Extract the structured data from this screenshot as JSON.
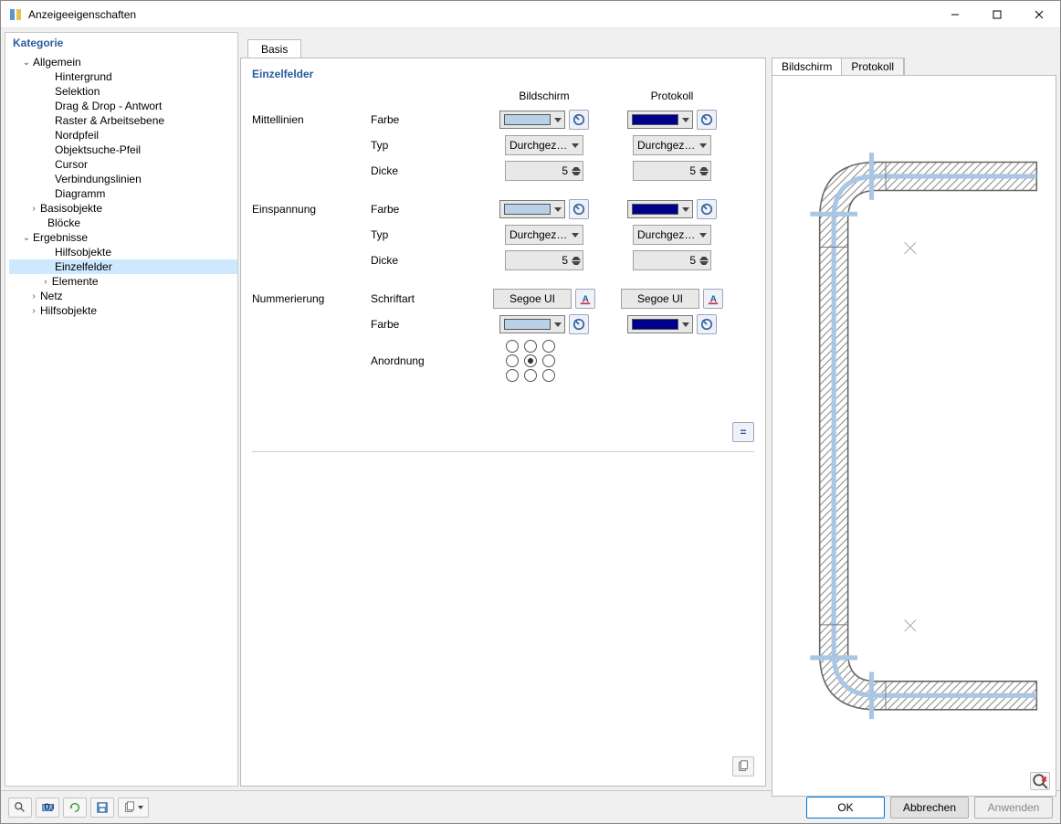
{
  "window": {
    "title": "Anzeigeeigenschaften"
  },
  "sidebar": {
    "header": "Kategorie",
    "items": [
      {
        "exp": "v",
        "label": "Allgemein"
      },
      {
        "exp": "",
        "label": "Hintergrund",
        "indent": 2
      },
      {
        "exp": "",
        "label": "Selektion",
        "indent": 2
      },
      {
        "exp": "",
        "label": "Drag & Drop - Antwort",
        "indent": 2
      },
      {
        "exp": "",
        "label": "Raster & Arbeitsebene",
        "indent": 2
      },
      {
        "exp": "",
        "label": "Nordpfeil",
        "indent": 2
      },
      {
        "exp": "",
        "label": "Objektsuche-Pfeil",
        "indent": 2
      },
      {
        "exp": "",
        "label": "Cursor",
        "indent": 2
      },
      {
        "exp": "",
        "label": "Verbindungslinien",
        "indent": 2
      },
      {
        "exp": "",
        "label": "Diagramm",
        "indent": 2
      },
      {
        "exp": ">",
        "label": "Basisobjekte",
        "indent": 1
      },
      {
        "exp": "",
        "label": "Blöcke",
        "indent": 1.5
      },
      {
        "exp": "v",
        "label": "Ergebnisse",
        "indent": 0.5
      },
      {
        "exp": "",
        "label": "Hilfsobjekte",
        "indent": 2
      },
      {
        "exp": "",
        "label": "Einzelfelder",
        "indent": 2,
        "selected": true
      },
      {
        "exp": ">",
        "label": "Elemente",
        "indent": 1.8
      },
      {
        "exp": ">",
        "label": "Netz",
        "indent": 1
      },
      {
        "exp": ">",
        "label": "Hilfsobjekte",
        "indent": 1
      }
    ]
  },
  "tabs": {
    "main": "Basis"
  },
  "settings": {
    "title": "Einzelfelder",
    "col_screen": "Bildschirm",
    "col_protocol": "Protokoll",
    "groups": {
      "mittellinien": {
        "label": "Mittellinien",
        "farbe": "Farbe",
        "typ": "Typ",
        "dicke": "Dicke",
        "typ_value": "Durchgezo...",
        "dicke_value": "5",
        "color_screen": "#b9d1e8",
        "color_protocol": "#00008b"
      },
      "einspannung": {
        "label": "Einspannung",
        "farbe": "Farbe",
        "typ": "Typ",
        "dicke": "Dicke",
        "typ_value": "Durchgezo...",
        "dicke_value": "5",
        "color_screen": "#b9d1e8",
        "color_protocol": "#00008b"
      },
      "nummerierung": {
        "label": "Nummerierung",
        "schriftart": "Schriftart",
        "farbe": "Farbe",
        "anordnung": "Anordnung",
        "font_value": "Segoe UI",
        "color_screen": "#b9d1e8",
        "color_protocol": "#00008b"
      }
    },
    "equal": "="
  },
  "preview": {
    "tab_screen": "Bildschirm",
    "tab_protocol": "Protokoll"
  },
  "footer": {
    "ok": "OK",
    "cancel": "Abbrechen",
    "apply": "Anwenden"
  }
}
